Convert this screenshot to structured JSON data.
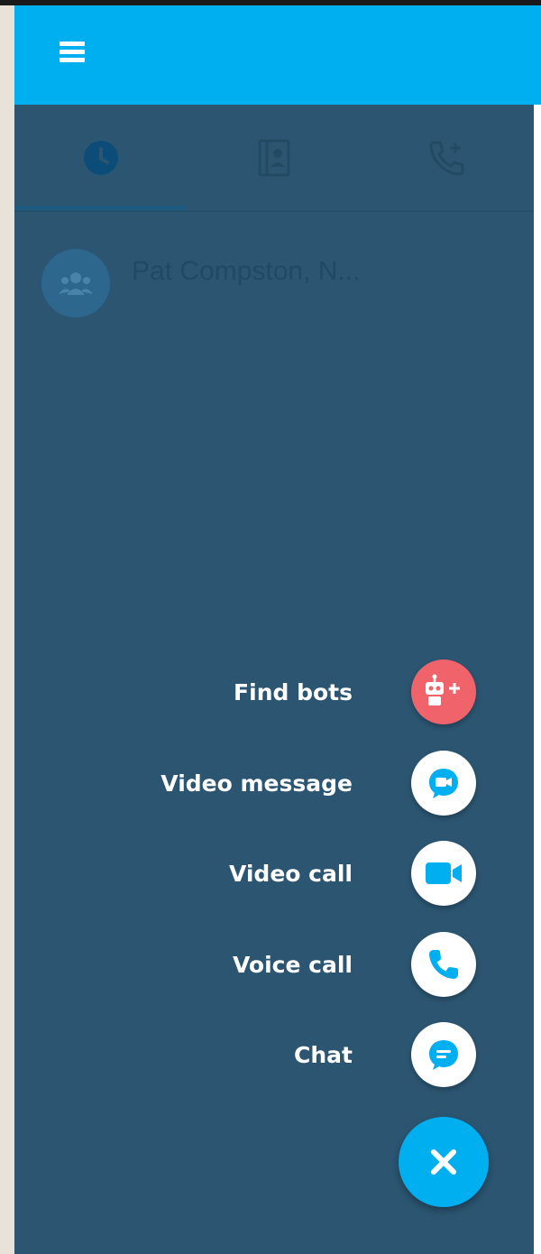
{
  "header": {
    "menu_icon": "hamburger-menu-icon",
    "background": "#00aff0"
  },
  "tabs": [
    {
      "icon": "recent-clock-icon",
      "active": true
    },
    {
      "icon": "contacts-book-icon",
      "active": false
    },
    {
      "icon": "call-add-icon",
      "active": false
    }
  ],
  "recent": {
    "items": [
      {
        "name": "Pat Compston, N...",
        "avatar_icon": "group-people-icon"
      }
    ]
  },
  "actions": [
    {
      "label": "Find bots",
      "icon": "robot-add-icon",
      "color": "#f0636b"
    },
    {
      "label": "Video message",
      "icon": "video-message-icon",
      "color": "#00aff0"
    },
    {
      "label": "Video call",
      "icon": "video-camera-icon",
      "color": "#00aff0"
    },
    {
      "label": "Voice call",
      "icon": "phone-icon",
      "color": "#00aff0"
    },
    {
      "label": "Chat",
      "icon": "chat-bubble-icon",
      "color": "#00aff0"
    }
  ],
  "fab": {
    "icon": "close-icon",
    "color": "#00aff0"
  },
  "colors": {
    "overlay": "#2b5571",
    "brand": "#00aff0"
  }
}
